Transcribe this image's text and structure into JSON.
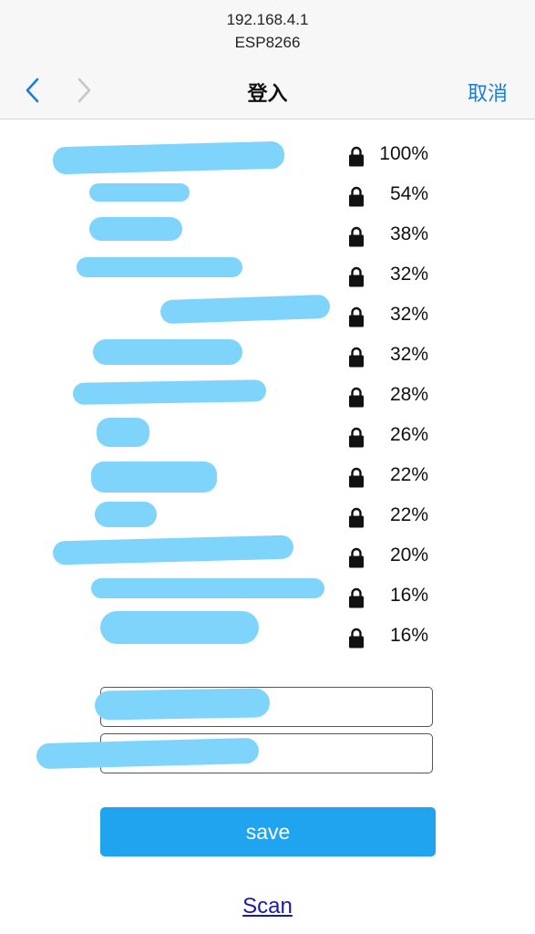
{
  "browser": {
    "host": "192.168.4.1",
    "page_title": "ESP8266",
    "nav_title": "登入",
    "cancel_label": "取消"
  },
  "networks": [
    {
      "name": "",
      "quality": "100%",
      "secured": true
    },
    {
      "name": "",
      "quality": "54%",
      "secured": true
    },
    {
      "name": "",
      "quality": "38%",
      "secured": true
    },
    {
      "name": "",
      "quality": "32%",
      "secured": true
    },
    {
      "name": "",
      "quality": "32%",
      "secured": true
    },
    {
      "name": "",
      "quality": "32%",
      "secured": true
    },
    {
      "name": "",
      "quality": "28%",
      "secured": true
    },
    {
      "name": "",
      "quality": "26%",
      "secured": true
    },
    {
      "name": "",
      "quality": "22%",
      "secured": true
    },
    {
      "name": "",
      "quality": "22%",
      "secured": true
    },
    {
      "name": "",
      "quality": "20%",
      "secured": true
    },
    {
      "name": "",
      "quality": "16%",
      "secured": true
    },
    {
      "name": "",
      "quality": "16%",
      "secured": true
    }
  ],
  "form": {
    "ssid_value": "",
    "password_value": "",
    "save_label": "save",
    "scan_label": "Scan"
  },
  "colors": {
    "link": "#1a1aa8",
    "accent_blue": "#1a7ed8",
    "save_button": "#20a4ef",
    "redaction": "#7fd4fb"
  }
}
